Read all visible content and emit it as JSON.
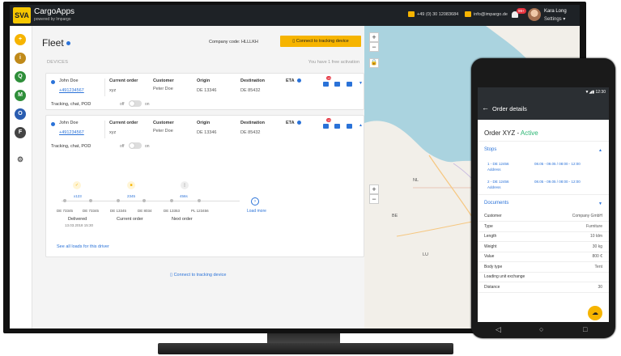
{
  "app": {
    "logo": "SVA",
    "name": "CargoApps",
    "powered_by": "powered by Impargo"
  },
  "topbar": {
    "phone": "+49 (0) 30 12083684",
    "email": "info@impargo.de",
    "notifications_count": "99+",
    "user_name": "Kara Long",
    "settings_label": "Settings"
  },
  "leftnav": [
    {
      "letter": "+",
      "color": "#f6b400"
    },
    {
      "letter": "i",
      "color": "#c08a1a"
    },
    {
      "letter": "Q",
      "color": "#2f8f3a"
    },
    {
      "letter": "M",
      "color": "#2f8f3a"
    },
    {
      "letter": "O",
      "color": "#2a5db0"
    },
    {
      "letter": "F",
      "color": "#444444"
    }
  ],
  "fleet": {
    "title": "Fleet",
    "company_code": "Company code: HLLLKH",
    "connect_button": "Connect to tracking device",
    "devices_label": "DEVICES",
    "free_activation": "You have 1 free activation",
    "headers": {
      "order": "Current order",
      "customer": "Customer",
      "origin": "Origin",
      "destination": "Destination",
      "eta": "ETA"
    },
    "devices": [
      {
        "name": "John Doe",
        "phone": "+491234567",
        "order": "xyz",
        "customer": "Peter Doe",
        "origin": "DE 13346",
        "destination": "DE 85432",
        "tracking": "Tracking, chat, POD",
        "off": "off",
        "on": "on",
        "messages": "13"
      },
      {
        "name": "John Doe",
        "phone": "+491234567",
        "order": "xyz",
        "customer": "Peter Doe",
        "origin": "DE 13346",
        "destination": "DE 85432",
        "tracking": "Tracking, chat, POD",
        "off": "off",
        "on": "on",
        "messages": "13"
      }
    ],
    "timeline": {
      "stops": [
        {
          "ref": "x123",
          "place_a": "DE 73345",
          "place_b": "DE 73345"
        },
        {
          "ref": "2345",
          "place_a": "DE 13345",
          "place_b": "DE 8034"
        },
        {
          "ref": "456s",
          "place_a": "DE 13353",
          "place_b": "PL 123456"
        }
      ],
      "labels": [
        "Delivered",
        "Current order",
        "Next order"
      ],
      "date": "13.03.2018 15:30",
      "load_more": "Load more"
    },
    "see_all": "See all loads for this driver",
    "connect_link": "Connect to tracking device"
  },
  "map": {
    "labels": [
      "NL",
      "BE",
      "LU"
    ]
  },
  "phone": {
    "time": "12:30",
    "title": "Order details",
    "order_title": "Order XYZ - ",
    "order_status": "Active",
    "stops_label": "Stops",
    "stops": [
      {
        "name": "1 - DE 12456",
        "addr": "Address",
        "time": "08.05 - 09.05 / 08:00 - 12:00"
      },
      {
        "name": "2 - DE 12456",
        "addr": "Address",
        "time": "08.05 - 09.05 / 08:00 - 12:00"
      }
    ],
    "documents_label": "Documents",
    "details": [
      {
        "k": "Customer",
        "v": "Company GmbH"
      },
      {
        "k": "Type",
        "v": "Furniture"
      },
      {
        "k": "Length",
        "v": "10 ldm"
      },
      {
        "k": "Weight",
        "v": "30 kg"
      },
      {
        "k": "Value",
        "v": "800 €"
      },
      {
        "k": "Body type",
        "v": "Tent"
      },
      {
        "k": "Loading unit exchange",
        "v": ""
      },
      {
        "k": "Distance",
        "v": "30"
      }
    ]
  }
}
